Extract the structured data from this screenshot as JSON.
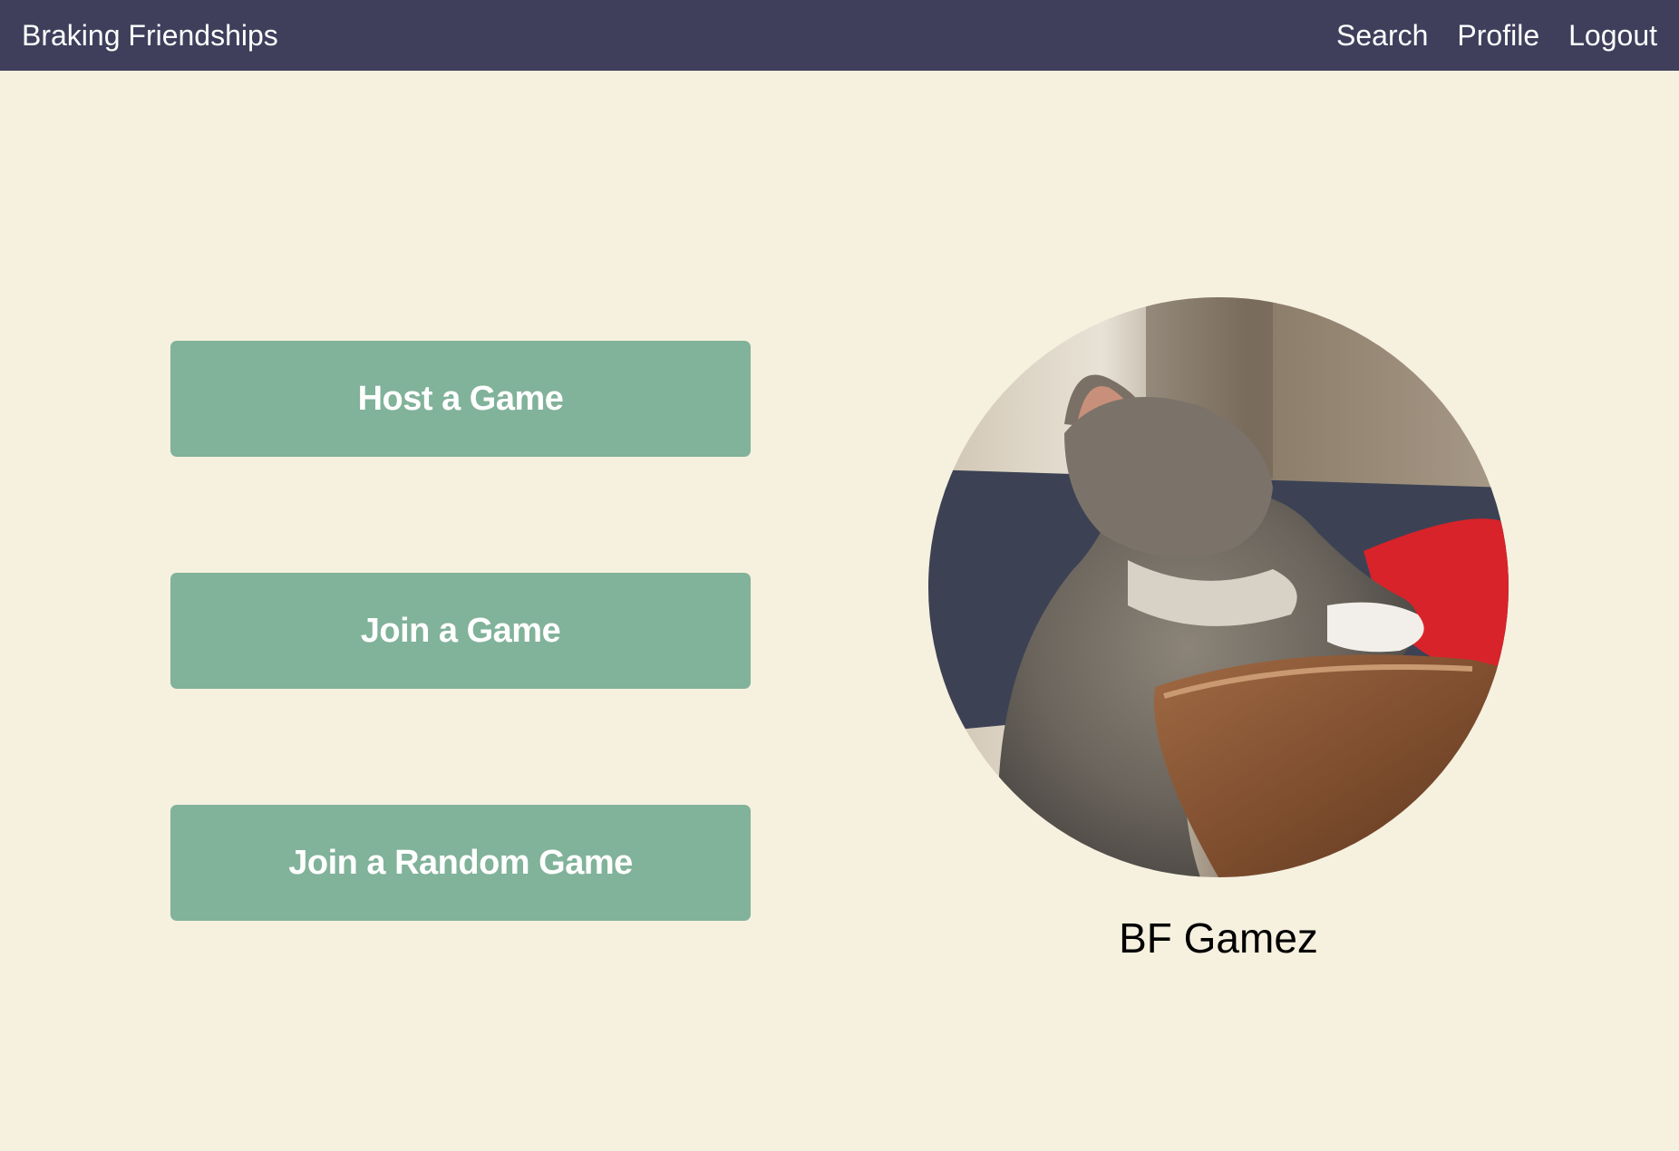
{
  "navbar": {
    "brand": "Braking Friendships",
    "links": [
      {
        "label": "Search"
      },
      {
        "label": "Profile"
      },
      {
        "label": "Logout"
      }
    ]
  },
  "actions": {
    "host_label": "Host a Game",
    "join_label": "Join a Game",
    "random_label": "Join a Random Game"
  },
  "profile": {
    "avatar_subject": "cat photo",
    "username": "BF Gamez"
  },
  "colors": {
    "navbar_bg": "#3f3f5c",
    "page_bg": "#f6f0df",
    "button_bg": "#81b29a",
    "button_text": "#ffffff"
  }
}
